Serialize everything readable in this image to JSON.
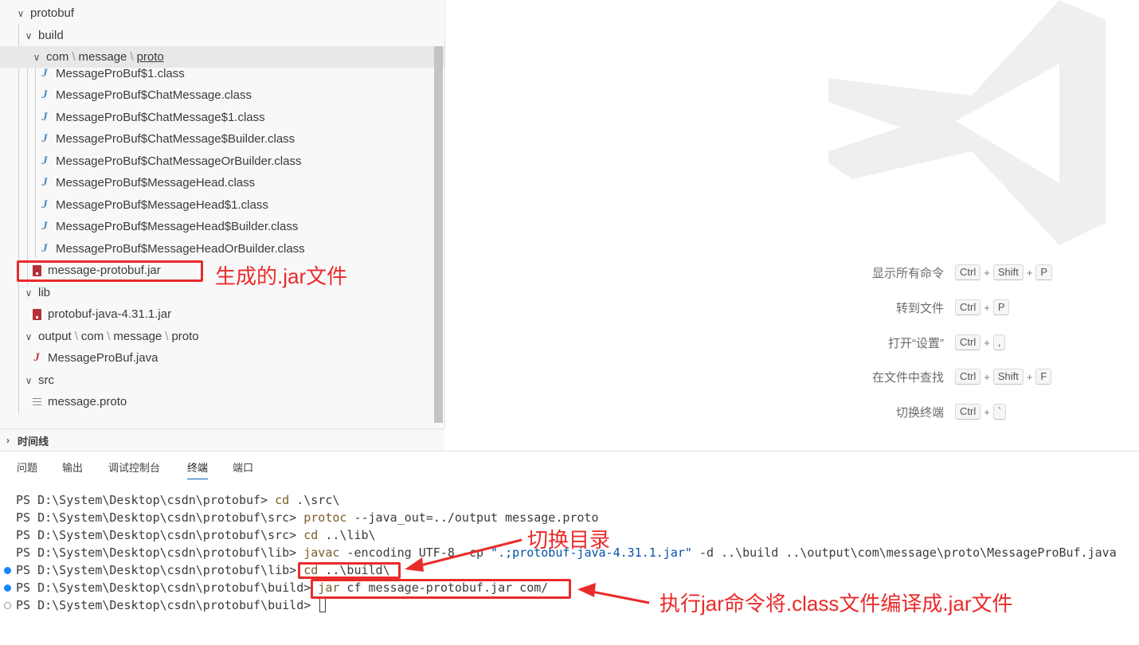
{
  "explorer": {
    "rows": [
      {
        "label": "protobuf"
      },
      {
        "label": "build"
      },
      {
        "path": [
          "com",
          "message",
          "proto"
        ]
      },
      {
        "label": "MessageProBuf$1.class"
      },
      {
        "label": "MessageProBuf$ChatMessage.class"
      },
      {
        "label": "MessageProBuf$ChatMessage$1.class"
      },
      {
        "label": "MessageProBuf$ChatMessage$Builder.class"
      },
      {
        "label": "MessageProBuf$ChatMessageOrBuilder.class"
      },
      {
        "label": "MessageProBuf$MessageHead.class"
      },
      {
        "label": "MessageProBuf$MessageHead$1.class"
      },
      {
        "label": "MessageProBuf$MessageHead$Builder.class"
      },
      {
        "label": "MessageProBuf$MessageHeadOrBuilder.class"
      },
      {
        "label": "message-protobuf.jar"
      },
      {
        "label": "lib"
      },
      {
        "label": "protobuf-java-4.31.1.jar"
      },
      {
        "path": [
          "output",
          "com",
          "message",
          "proto"
        ]
      },
      {
        "label": "MessageProBuf.java"
      },
      {
        "label": "src"
      },
      {
        "label": "message.proto"
      }
    ],
    "separator": "\\"
  },
  "timeline": {
    "label": "时间线"
  },
  "annotations": {
    "jar_generated": "生成的.jar文件",
    "switch_dir": "切换目录",
    "exec_jar": "执行jar命令将.class文件编译成.jar文件",
    "color": "#ea2b2b"
  },
  "shortcuts": [
    {
      "label": "显示所有命令",
      "keys": [
        "Ctrl",
        "Shift",
        "P"
      ]
    },
    {
      "label": "转到文件",
      "keys": [
        "Ctrl",
        "P"
      ]
    },
    {
      "label": "打开“设置”",
      "keys": [
        "Ctrl",
        ","
      ]
    },
    {
      "label": "在文件中查找",
      "keys": [
        "Ctrl",
        "Shift",
        "F"
      ]
    },
    {
      "label": "切换终端",
      "keys": [
        "Ctrl",
        "`"
      ]
    }
  ],
  "panel": {
    "tabs": [
      "问题",
      "输出",
      "调试控制台",
      "终端",
      "端口"
    ],
    "active_tab": "终端"
  },
  "terminal": {
    "lines": [
      {
        "prompt": "PS D:\\System\\Desktop\\csdn\\protobuf> ",
        "cmd": "cd",
        "args": " .\\src\\"
      },
      {
        "prompt": "PS D:\\System\\Desktop\\csdn\\protobuf\\src> ",
        "cmd": "protoc",
        "args": " --java_out=../output message.proto"
      },
      {
        "prompt": "PS D:\\System\\Desktop\\csdn\\protobuf\\src> ",
        "cmd": "cd",
        "args": " ..\\lib\\"
      },
      {
        "prompt": "PS D:\\System\\Desktop\\csdn\\protobuf\\lib> ",
        "cmd": "javac",
        "args": " -encoding UTF-8 -cp ",
        "str": "\".;protobuf-java-4.31.1.jar\"",
        "tail": " -d ..\\build ..\\output\\com\\message\\proto\\MessageProBuf.java"
      },
      {
        "prompt": "PS D:\\System\\Desktop\\csdn\\protobuf\\lib> ",
        "cmd": "cd",
        "args": " ..\\build\\"
      },
      {
        "prompt": "PS D:\\System\\Desktop\\csdn\\protobuf\\build> ",
        "cmd": "jar",
        "args": " cf message-protobuf.jar com/"
      },
      {
        "prompt": "PS D:\\System\\Desktop\\csdn\\protobuf\\build> ",
        "cmd": "",
        "args": ""
      }
    ]
  }
}
